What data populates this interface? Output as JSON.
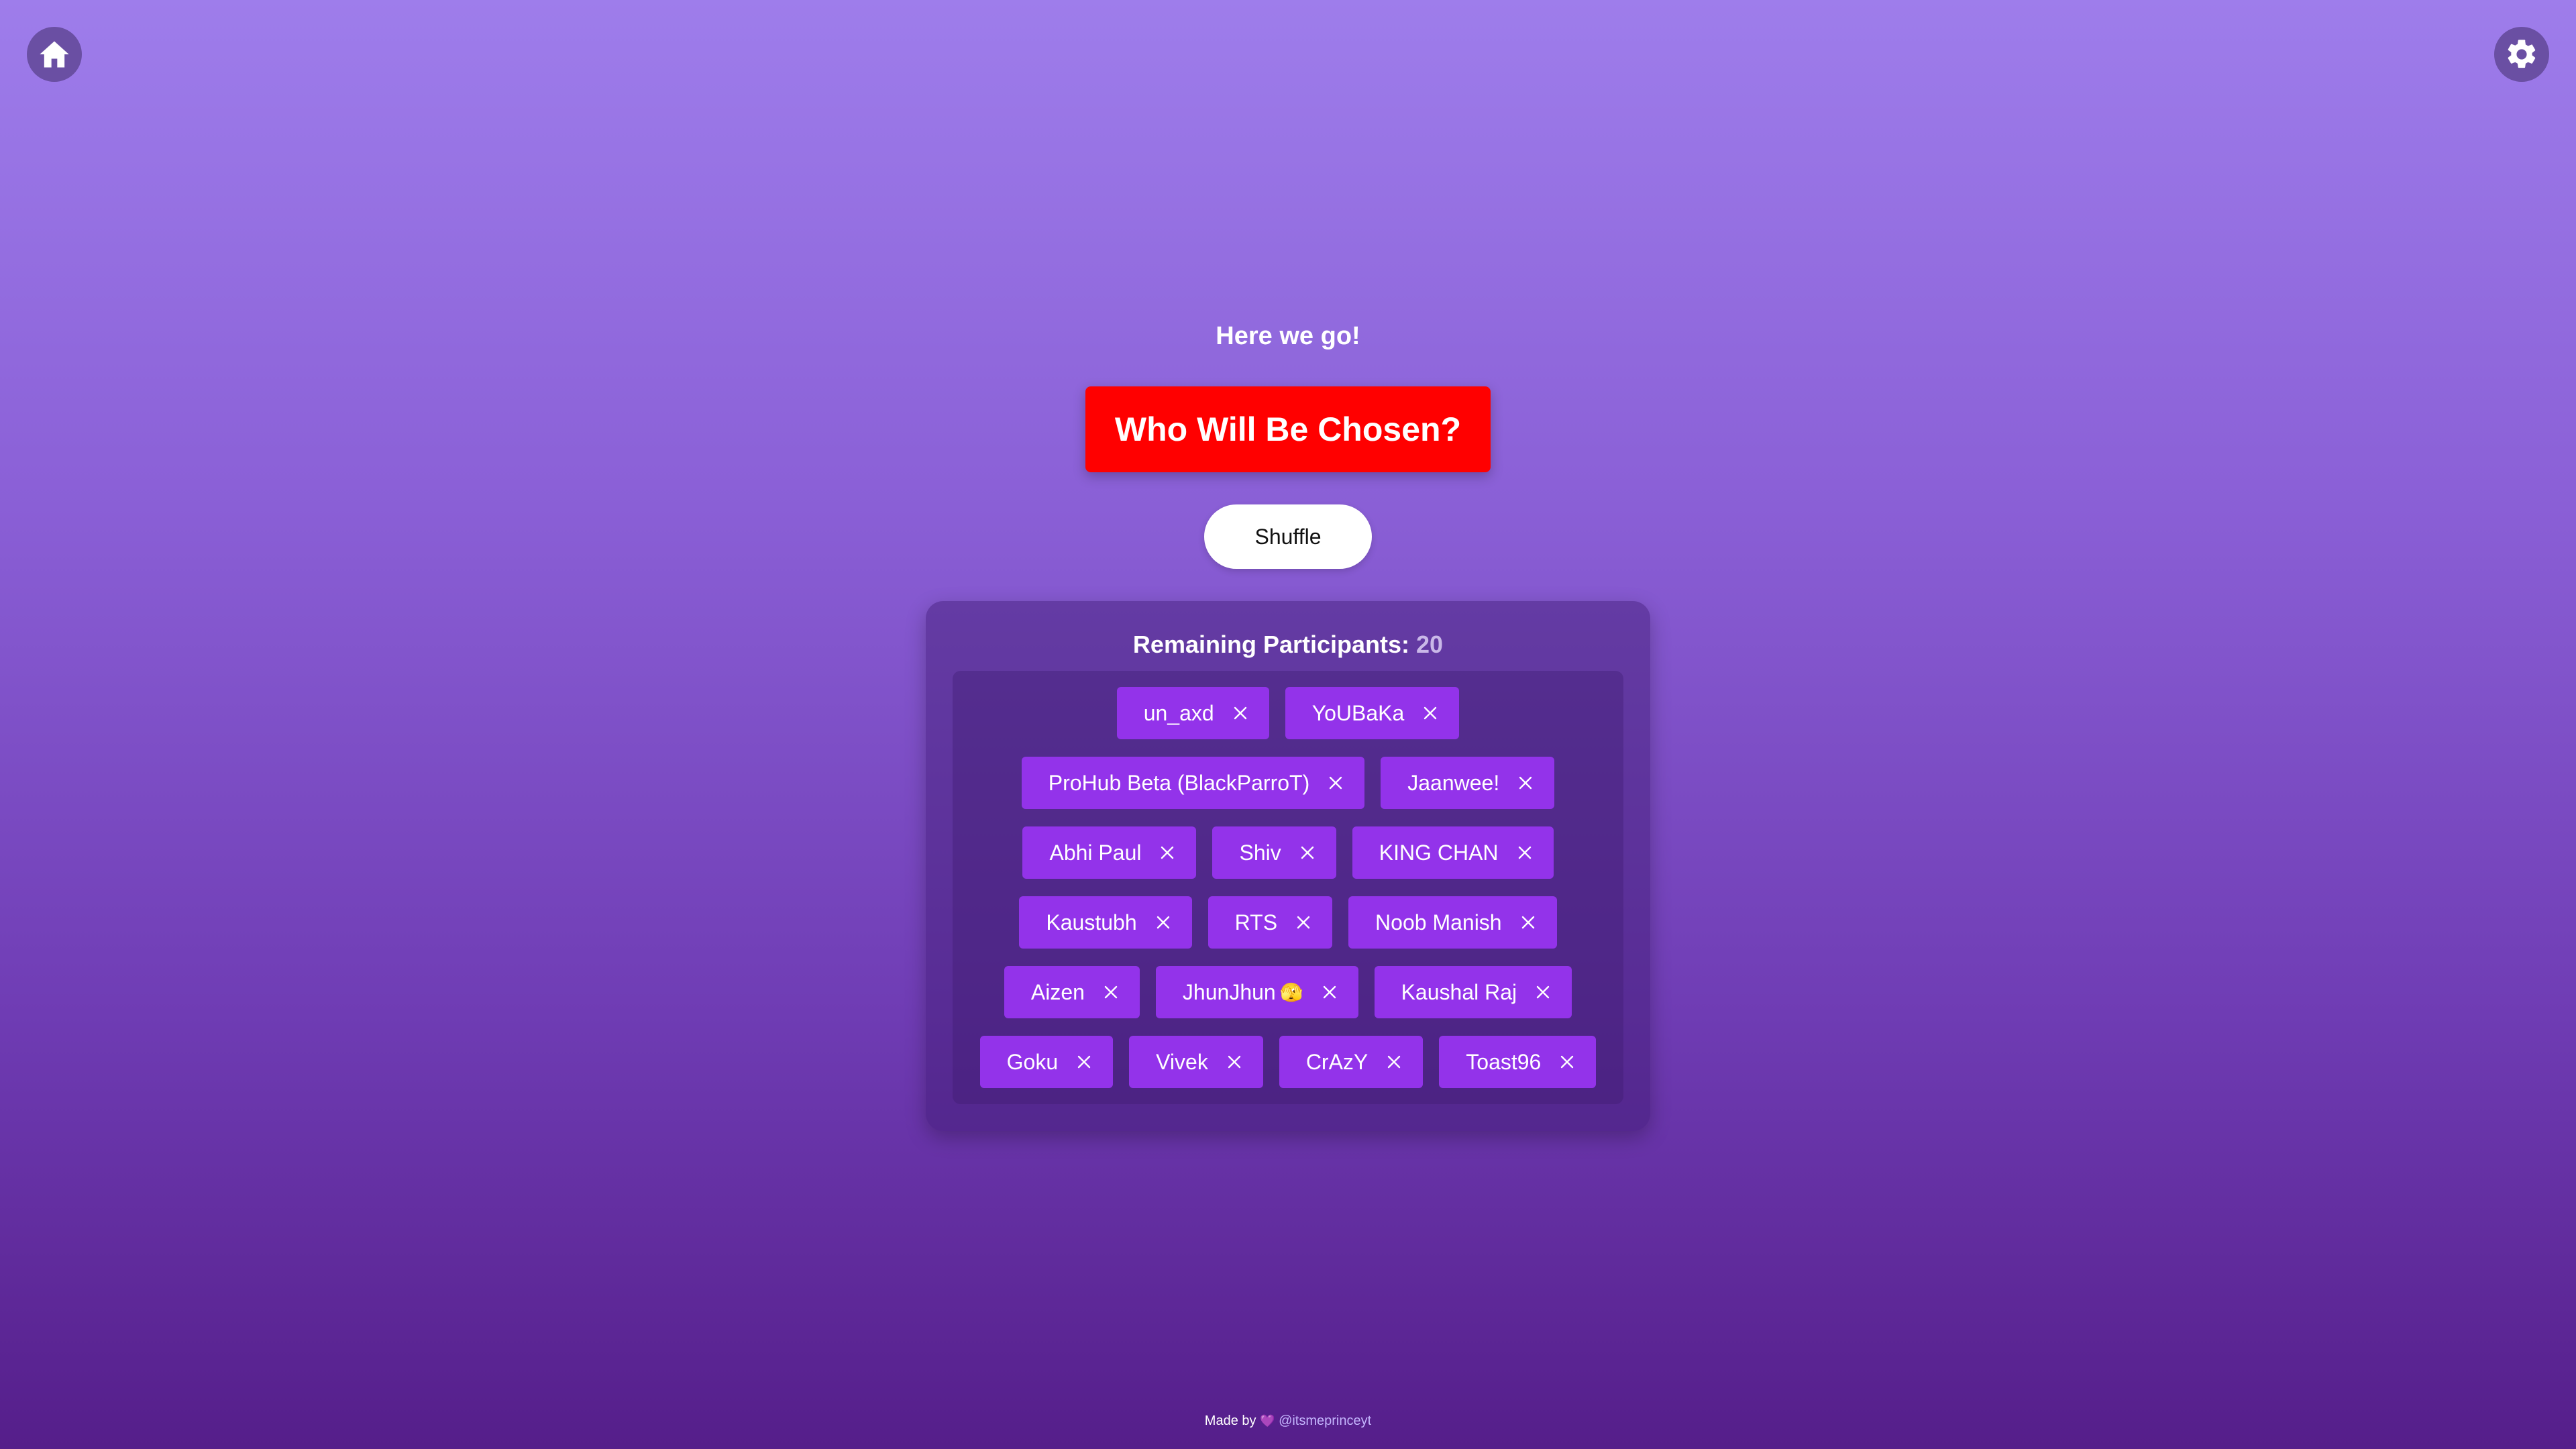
{
  "header": {
    "home_icon": "home-icon",
    "settings_icon": "gear-icon"
  },
  "main": {
    "subtitle": "Here we go!",
    "chosen_label": "Who Will Be Chosen?",
    "shuffle_label": "Shuffle"
  },
  "participants": {
    "title_label": "Remaining Participants:",
    "count": "20",
    "rows": [
      [
        {
          "name": "un_axd"
        },
        {
          "name": "YoUBaKa"
        }
      ],
      [
        {
          "name": "ProHub Beta (BlackParroT)"
        },
        {
          "name": "Jaanwee!"
        }
      ],
      [
        {
          "name": "Abhi Paul"
        },
        {
          "name": "Shiv"
        },
        {
          "name": "KING CHAN"
        }
      ],
      [
        {
          "name": "Kaustubh"
        },
        {
          "name": "RTS"
        },
        {
          "name": "Noob Manish"
        }
      ],
      [
        {
          "name": "Aizen"
        },
        {
          "name": "JhunJhun",
          "emoji": "🫣"
        },
        {
          "name": "Kaushal Raj"
        }
      ],
      [
        {
          "name": "Goku"
        },
        {
          "name": "Vivek"
        },
        {
          "name": "CrAzY"
        },
        {
          "name": "Toast96"
        }
      ]
    ]
  },
  "footer": {
    "made_by": "Made by",
    "heart": "💜",
    "handle": "@itsmeprinceyt"
  },
  "colors": {
    "accent_red": "#ff0000",
    "chip_purple": "#9333ea"
  }
}
